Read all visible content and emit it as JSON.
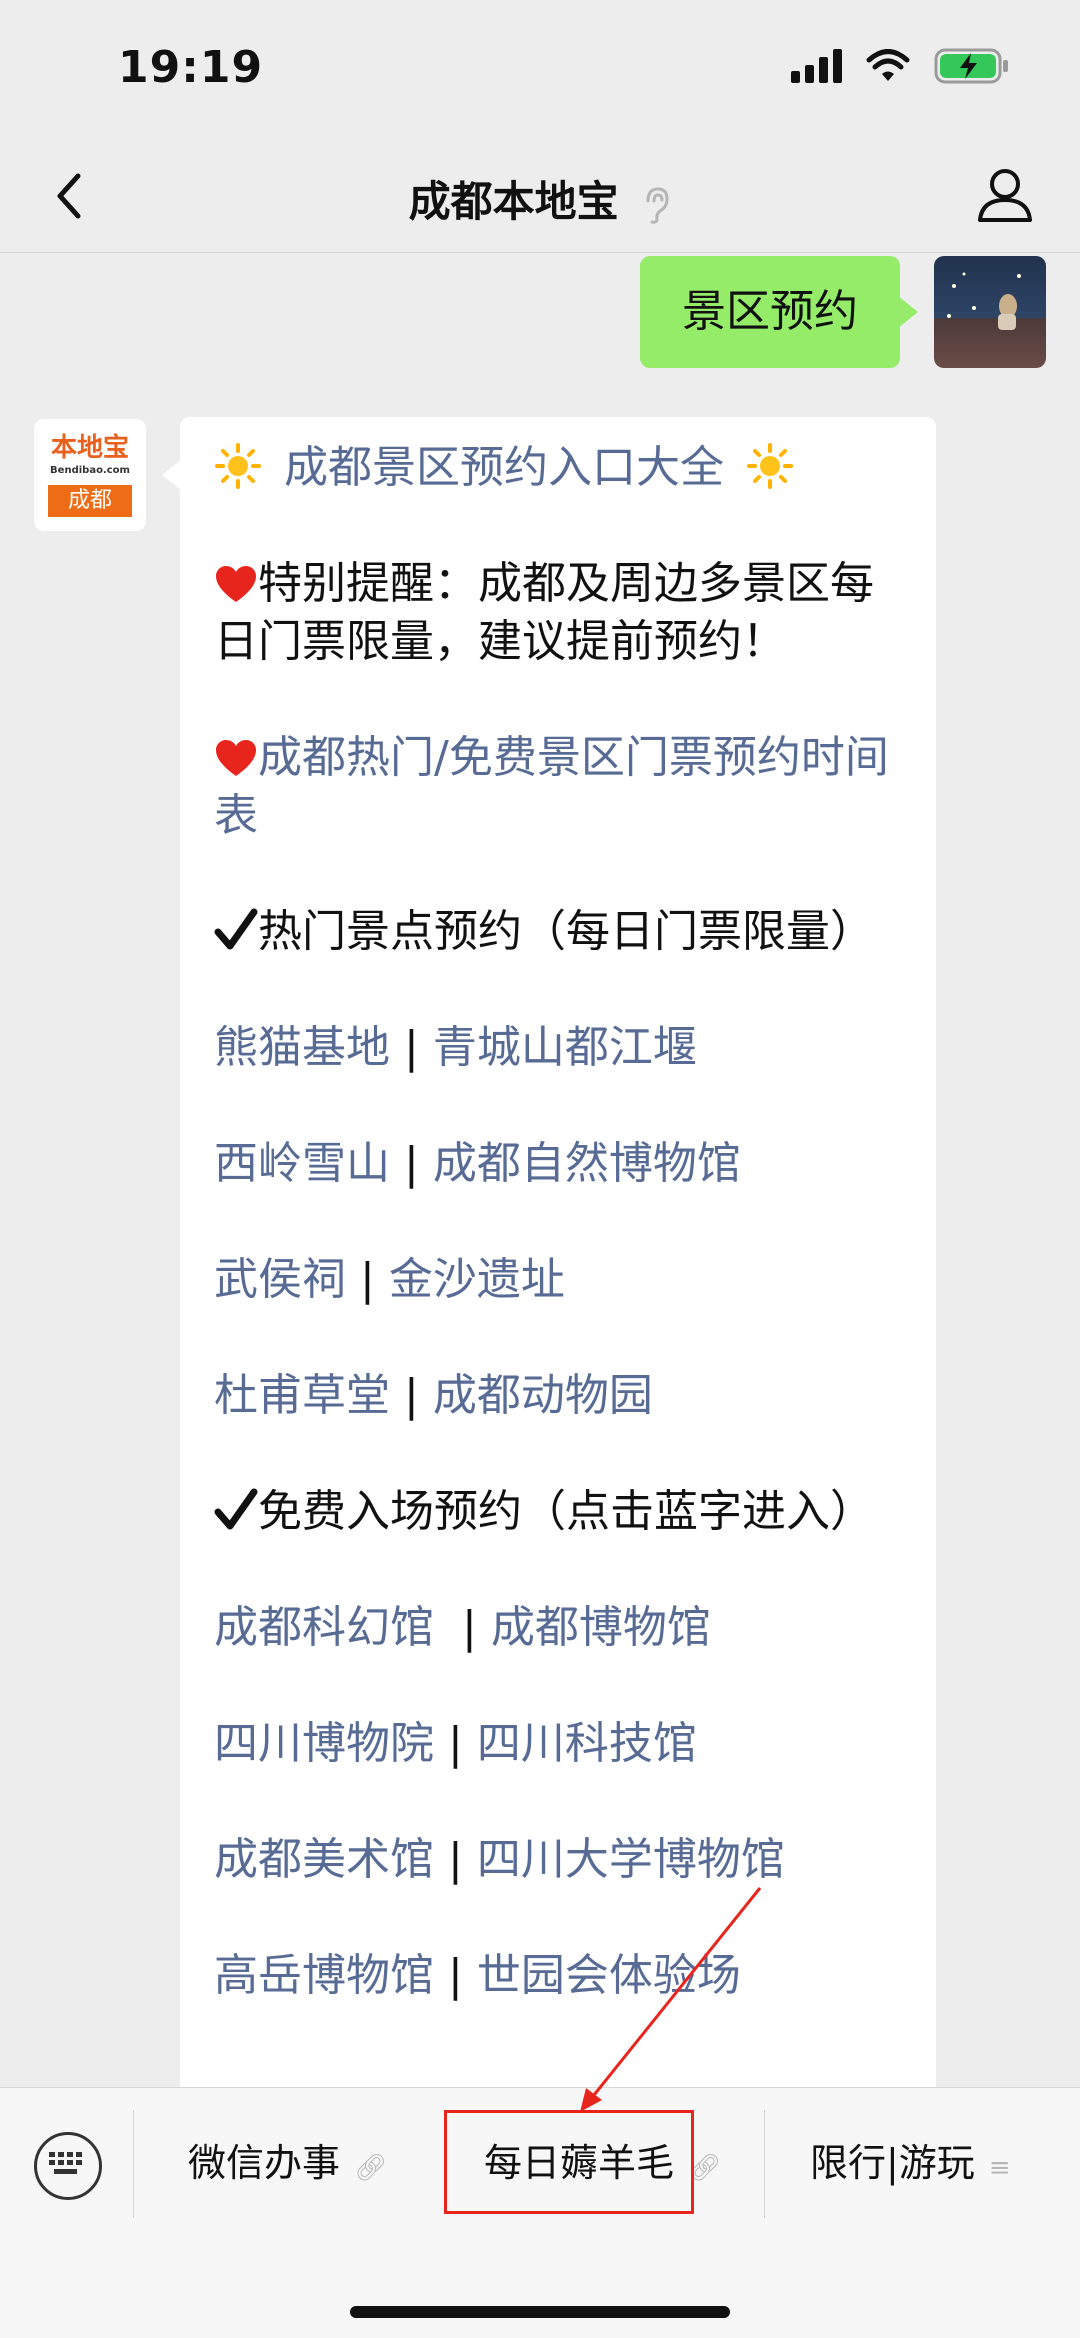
{
  "status_bar": {
    "time": "19:19"
  },
  "nav": {
    "title": "成都本地宝"
  },
  "user_message": "景区预约",
  "bot_avatar": {
    "logo_top": "本地宝",
    "logo_mid": "Bendibao.com",
    "logo_city": "成都"
  },
  "article": {
    "title": "成都景区预约入口大全",
    "reminder": "特别提醒：成都及周边多景区每日门票限量，建议提前预约！",
    "schedule_link": "成都热门/免费景区门票预约时间表",
    "hot_header": "热门景点预约（每日门票限量）",
    "hot_rows": [
      [
        "熊猫基地",
        "青城山都江堰"
      ],
      [
        "西岭雪山",
        "成都自然博物馆"
      ],
      [
        "武侯祠",
        "金沙遗址"
      ],
      [
        "杜甫草堂",
        "成都动物园"
      ]
    ],
    "free_header": "免费入场预约（点击蓝字进入）",
    "free_rows": [
      [
        "成都科幻馆",
        "成都博物馆"
      ],
      [
        "四川博物院",
        "四川科技馆"
      ],
      [
        "成都美术馆",
        "四川大学博物馆"
      ],
      [
        "高岳博物馆",
        "世园会体验场"
      ]
    ],
    "separator": "|"
  },
  "menu": {
    "items": [
      "微信办事",
      "每日薅羊毛",
      "限行|游玩"
    ]
  },
  "colors": {
    "link": "#576b95",
    "user_bubble": "#95ec69",
    "highlight": "#e8251d"
  }
}
